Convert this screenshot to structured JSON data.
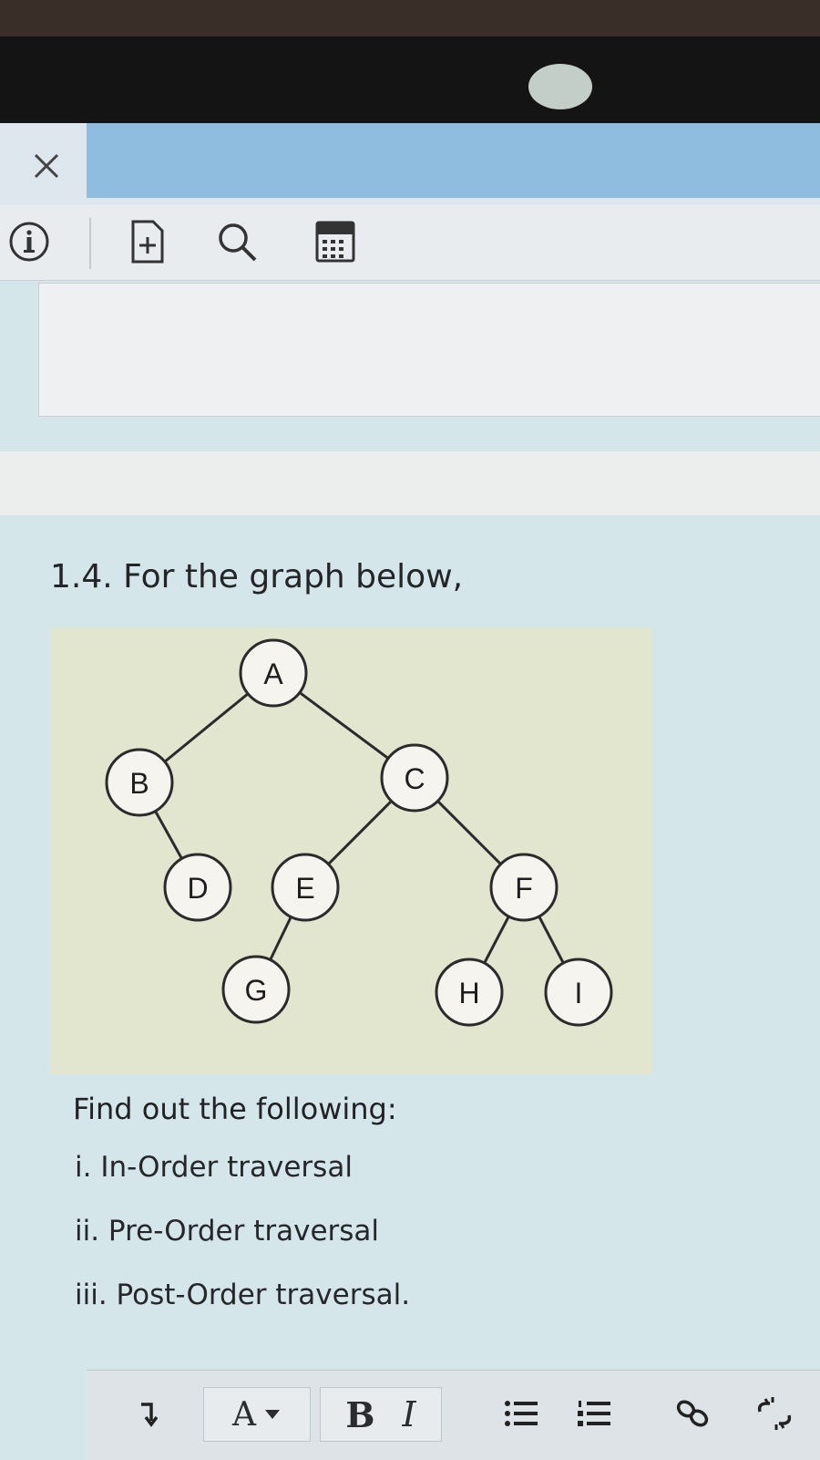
{
  "question": {
    "title": "1.4. For the graph below,",
    "prompt": "Find out the following:",
    "items": [
      "i. In-Order traversal",
      "ii. Pre-Order traversal",
      "iii. Post-Order traversal."
    ]
  },
  "tree": {
    "nodes": [
      "A",
      "B",
      "C",
      "D",
      "E",
      "F",
      "G",
      "H",
      "I"
    ],
    "edges": [
      [
        "A",
        "B"
      ],
      [
        "A",
        "C"
      ],
      [
        "B",
        "D"
      ],
      [
        "C",
        "E"
      ],
      [
        "C",
        "F"
      ],
      [
        "E",
        "G"
      ],
      [
        "F",
        "H"
      ],
      [
        "F",
        "I"
      ]
    ]
  },
  "toolbar": {
    "icons": [
      "info-icon",
      "add-page-icon",
      "search-icon",
      "calculator-icon"
    ]
  },
  "editor": {
    "font_color_label": "A",
    "bold_label": "B",
    "italic_label": "I"
  },
  "colors": {
    "title_bar_blue": "#8fbde0",
    "page_background": "#d4e6ea"
  }
}
